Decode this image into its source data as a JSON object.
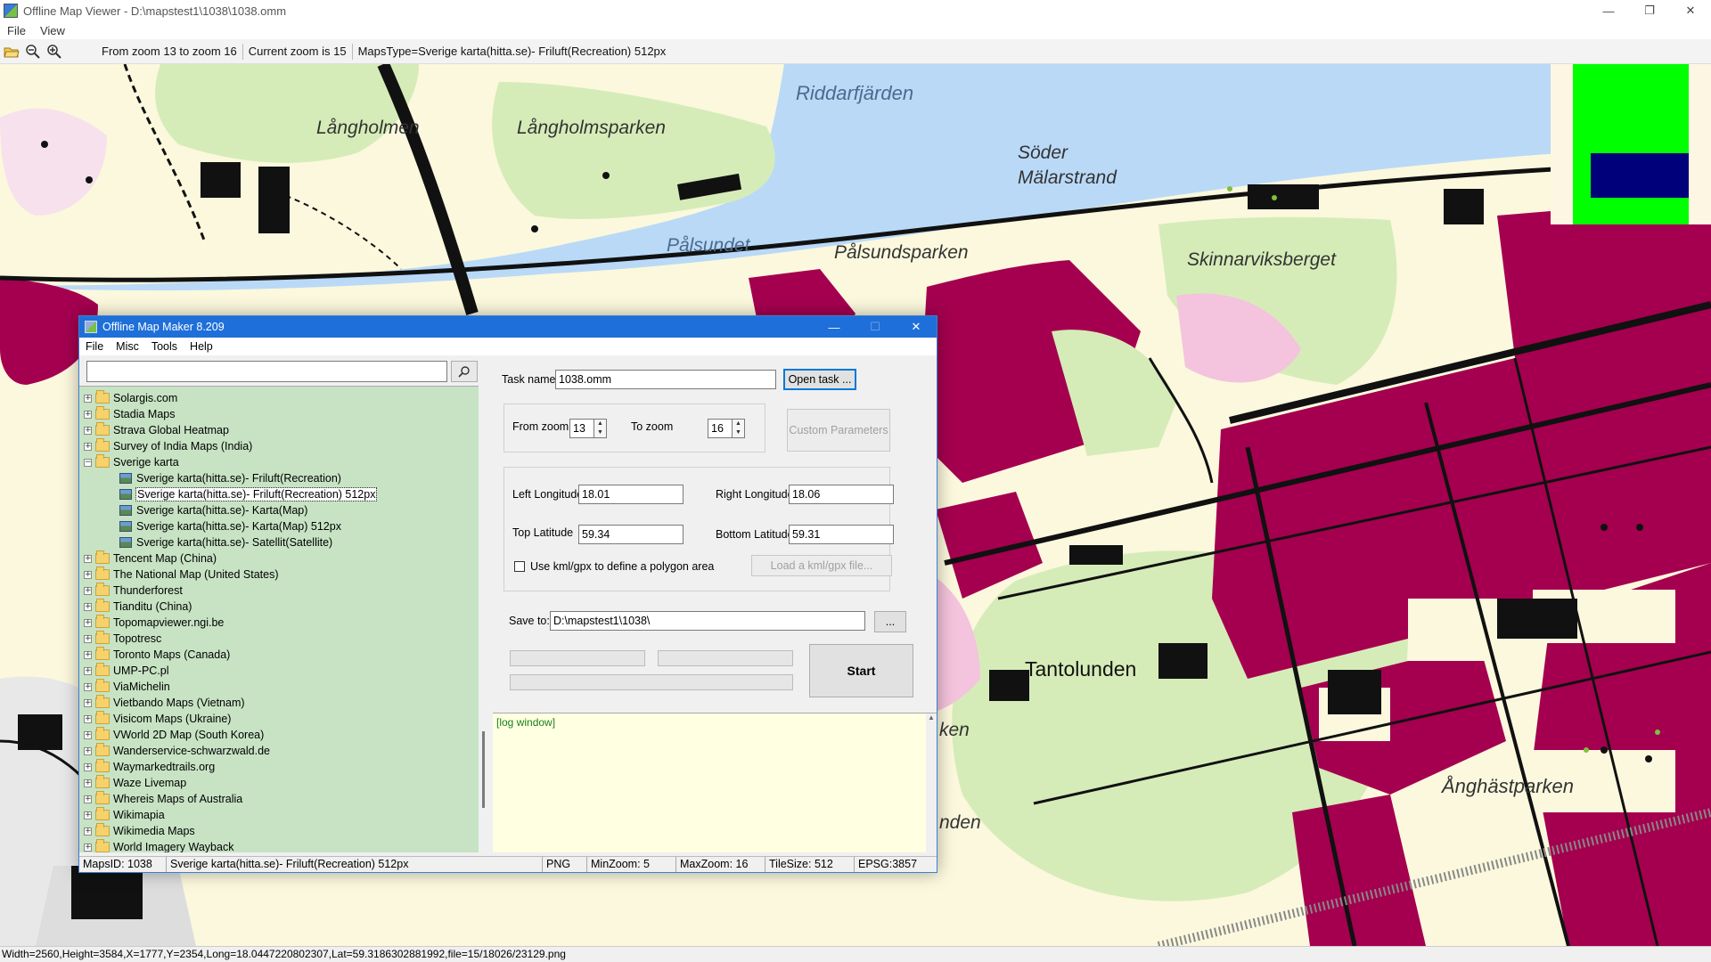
{
  "viewer": {
    "title": "Offline Map Viewer - D:\\mapstest1\\1038\\1038.omm",
    "controls": {
      "minimize": "—",
      "maximize": "❐",
      "close": "✕"
    },
    "menu": [
      "File",
      "View"
    ],
    "toolbar": {
      "zoom_range": "From zoom 13 to zoom 16",
      "current_zoom": "Current zoom is 15",
      "maps_type": "MapsType=Sverige karta(hitta.se)- Friluft(Recreation) 512px"
    },
    "map_labels": {
      "langholmen": "Långholmen",
      "langholmsparken": "Långholmsparken",
      "riddarfjarden": "Riddarfjärden",
      "soder": "Söder",
      "malarstrand": "Mälarstrand",
      "palsundet": "Pålsundet",
      "palsundsparken": "Pålsundsparken",
      "skinnarviksberget": "Skinnarviksberget",
      "tantolunden": "Tantolunden",
      "anghastparken": "Ånghästparken",
      "partial_ken": "ken",
      "partial_nden": "nden"
    },
    "status": "Width=2560,Height=3584,X=1777,Y=2354,Long=18.0447220802307,Lat=59.3186302881992,file=15/18026/23129.png"
  },
  "dialog": {
    "title": "Offline Map Maker 8.209",
    "controls": {
      "minimize": "—",
      "maximize": "☐",
      "close": "✕"
    },
    "menu": [
      "File",
      "Misc",
      "Tools",
      "Help"
    ],
    "search": {
      "value": "",
      "placeholder": ""
    },
    "tree": [
      {
        "label": "Solargis.com",
        "kind": "folder",
        "exp": "+"
      },
      {
        "label": "Stadia Maps",
        "kind": "folder",
        "exp": "+"
      },
      {
        "label": "Strava Global Heatmap",
        "kind": "folder",
        "exp": "+"
      },
      {
        "label": "Survey of India Maps (India)",
        "kind": "folder",
        "exp": "+"
      },
      {
        "label": "Sverige karta",
        "kind": "folder-open",
        "exp": "−"
      },
      {
        "label": "Sverige karta(hitta.se)- Friluft(Recreation)",
        "kind": "map"
      },
      {
        "label": "Sverige karta(hitta.se)- Friluft(Recreation) 512px",
        "kind": "map",
        "selected": true
      },
      {
        "label": "Sverige karta(hitta.se)- Karta(Map)",
        "kind": "map"
      },
      {
        "label": "Sverige karta(hitta.se)- Karta(Map) 512px",
        "kind": "map"
      },
      {
        "label": "Sverige karta(hitta.se)- Satellit(Satellite)",
        "kind": "map"
      },
      {
        "label": "Tencent Map (China)",
        "kind": "folder",
        "exp": "+"
      },
      {
        "label": "The National Map (United States)",
        "kind": "folder",
        "exp": "+"
      },
      {
        "label": "Thunderforest",
        "kind": "folder",
        "exp": "+"
      },
      {
        "label": "Tianditu (China)",
        "kind": "folder",
        "exp": "+"
      },
      {
        "label": "Topomapviewer.ngi.be",
        "kind": "folder",
        "exp": "+"
      },
      {
        "label": "Topotresc",
        "kind": "folder",
        "exp": "+"
      },
      {
        "label": "Toronto Maps (Canada)",
        "kind": "folder",
        "exp": "+"
      },
      {
        "label": "UMP-PC.pl",
        "kind": "folder",
        "exp": "+"
      },
      {
        "label": "ViaMichelin",
        "kind": "folder",
        "exp": "+"
      },
      {
        "label": "Vietbando Maps (Vietnam)",
        "kind": "folder",
        "exp": "+"
      },
      {
        "label": "Visicom Maps (Ukraine)",
        "kind": "folder",
        "exp": "+"
      },
      {
        "label": "VWorld 2D Map (South Korea)",
        "kind": "folder",
        "exp": "+"
      },
      {
        "label": "Wanderservice-schwarzwald.de",
        "kind": "folder",
        "exp": "+"
      },
      {
        "label": "Waymarkedtrails.org",
        "kind": "folder",
        "exp": "+"
      },
      {
        "label": "Waze Livemap",
        "kind": "folder",
        "exp": "+"
      },
      {
        "label": "Whereis Maps of Australia",
        "kind": "folder",
        "exp": "+"
      },
      {
        "label": "Wikimapia",
        "kind": "folder",
        "exp": "+"
      },
      {
        "label": "Wikimedia Maps",
        "kind": "folder",
        "exp": "+"
      },
      {
        "label": "World Imagery Wayback",
        "kind": "folder",
        "exp": "+"
      }
    ],
    "form": {
      "task_name_label": "Task name",
      "task_name_value": "1038.omm",
      "open_task": "Open task ...",
      "from_zoom_label": "From zoom",
      "from_zoom_value": "13",
      "to_zoom_label": "To zoom",
      "to_zoom_value": "16",
      "custom_params": "Custom Parameters",
      "left_lon_label": "Left Longitude",
      "left_lon_value": "18.01",
      "right_lon_label": "Right Longitude",
      "right_lon_value": "18.06",
      "top_lat_label": "Top Latitude",
      "top_lat_value": "59.34",
      "bottom_lat_label": "Bottom Latitude",
      "bottom_lat_value": "59.31",
      "kml_label": "Use kml/gpx to define a polygon area",
      "load_kml": "Load a kml/gpx file...",
      "save_to_label": "Save to:",
      "save_to_value": "D:\\mapstest1\\1038\\",
      "browse": "...",
      "start": "Start",
      "log": "[log window]"
    },
    "status": {
      "maps_id": "MapsID: 1038",
      "name": "Sverige karta(hitta.se)- Friluft(Recreation) 512px",
      "format": "PNG",
      "min_zoom": "MinZoom: 5",
      "max_zoom": "MaxZoom: 16",
      "tile_size": "TileSize: 512",
      "epsg": "EPSG:3857"
    }
  },
  "colors": {
    "water": "#b9d9f7",
    "park": "#d6ecb8",
    "urban": "#a4004f",
    "land": "#fbf8dd",
    "tree_bg": "#c7e3c4",
    "log_bg": "#ffffe1",
    "dialog_title": "#1e6fd9"
  }
}
